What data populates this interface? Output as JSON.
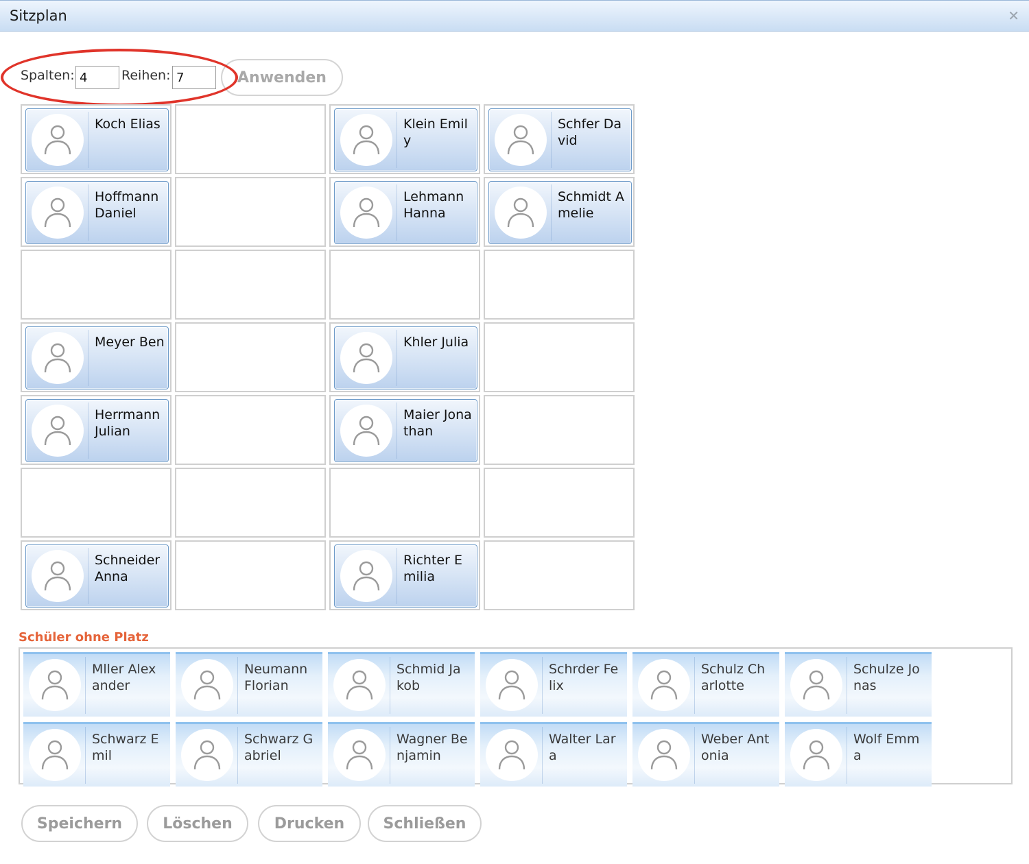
{
  "window": {
    "title": "Sitzplan",
    "close_icon": "close-icon"
  },
  "controls": {
    "columns_label": "Spalten:",
    "columns_value": "4",
    "rows_label": "Reihen:",
    "rows_value": "7",
    "apply_label": "Anwenden"
  },
  "seat_grid": {
    "columns": 4,
    "rows": 7,
    "cells": [
      [
        "Koch Elias",
        "",
        "Klein Emily",
        "Schfer David"
      ],
      [
        "Hoffmann Daniel",
        "",
        "Lehmann Hanna",
        "Schmidt Amelie"
      ],
      [
        "",
        "",
        "",
        ""
      ],
      [
        "Meyer Ben",
        "",
        "Khler Julia",
        ""
      ],
      [
        "Herrmann Julian",
        "",
        "Maier Jonathan",
        ""
      ],
      [
        "",
        "",
        "",
        ""
      ],
      [
        "Schneider Anna",
        "",
        "Richter Emilia",
        ""
      ]
    ]
  },
  "unassigned": {
    "title": "Schüler ohne Platz",
    "students": [
      "Mller Alexander",
      "Neumann Florian",
      "Schmid Jakob",
      "Schrder Felix",
      "Schulz Charlotte",
      "Schulze Jonas",
      "Schwarz Emil",
      "Schwarz Gabriel",
      "Wagner Benjamin",
      "Walter Lara",
      "Weber Antonia",
      "Wolf Emma"
    ]
  },
  "footer": {
    "save_label": "Speichern",
    "delete_label": "Löschen",
    "print_label": "Drucken",
    "close_label": "Schließen"
  },
  "colors": {
    "annotation_ellipse": "#e0342a",
    "section_title": "#e5643a",
    "card_border": "#6e9bc9"
  }
}
